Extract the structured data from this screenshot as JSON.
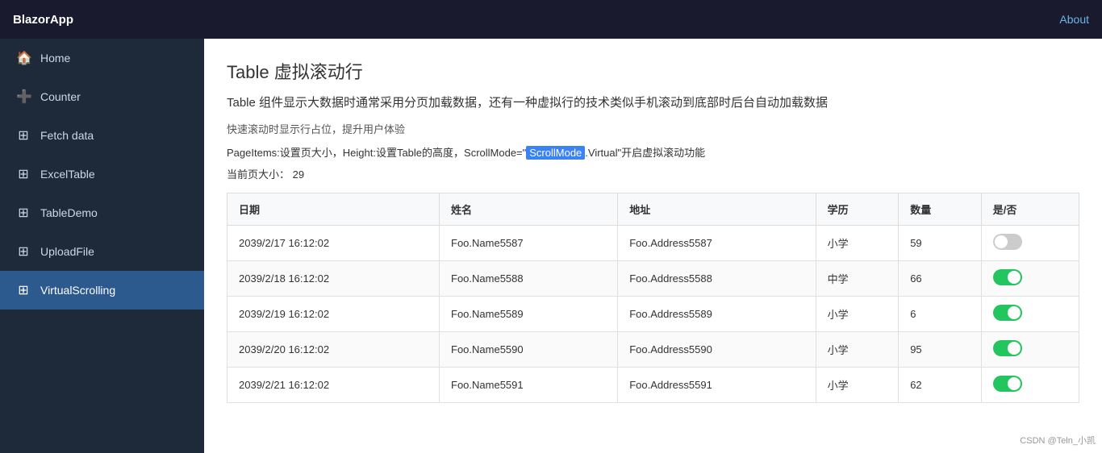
{
  "navbar": {
    "brand": "BlazorApp",
    "about_label": "About"
  },
  "sidebar": {
    "items": [
      {
        "id": "home",
        "label": "Home",
        "icon": "🏠",
        "active": false
      },
      {
        "id": "counter",
        "label": "Counter",
        "icon": "➕",
        "active": false
      },
      {
        "id": "fetch-data",
        "label": "Fetch data",
        "icon": "⊞",
        "active": false
      },
      {
        "id": "excel-table",
        "label": "ExcelTable",
        "icon": "⊞",
        "active": false
      },
      {
        "id": "table-demo",
        "label": "TableDemo",
        "icon": "⊞",
        "active": false
      },
      {
        "id": "upload-file",
        "label": "UploadFile",
        "icon": "⊞",
        "active": false
      },
      {
        "id": "virtual-scrolling",
        "label": "VirtualScrolling",
        "icon": "⊞",
        "active": true
      }
    ]
  },
  "main": {
    "title": "Table 虚拟滚动行",
    "description": "Table 组件显示大数据时通常采用分页加载数据，还有一种虚拟行的技术类似手机滚动到底部时后台自动加载数据",
    "subtitle": "快速滚动时显示行占位，提升用户体验",
    "params_prefix": "PageItems:设置页大小，Height:设置Table的高度，ScrollMode=\"",
    "params_highlight": "ScrollMode",
    "params_suffix": ".Virtual\"开启虚拟滚动功能",
    "page_size_label": "当前页大小：",
    "page_size_value": "29",
    "table": {
      "headers": [
        "日期",
        "姓名",
        "地址",
        "学历",
        "数量",
        "是/否"
      ],
      "rows": [
        {
          "date": "2039/2/17 16:12:02",
          "name": "Foo.Name5587",
          "address": "Foo.Address5587",
          "education": "小学",
          "quantity": "59",
          "toggle": false
        },
        {
          "date": "2039/2/18 16:12:02",
          "name": "Foo.Name5588",
          "address": "Foo.Address5588",
          "education": "中学",
          "quantity": "66",
          "toggle": true
        },
        {
          "date": "2039/2/19 16:12:02",
          "name": "Foo.Name5589",
          "address": "Foo.Address5589",
          "education": "小学",
          "quantity": "6",
          "toggle": true
        },
        {
          "date": "2039/2/20 16:12:02",
          "name": "Foo.Name5590",
          "address": "Foo.Address5590",
          "education": "小学",
          "quantity": "95",
          "toggle": true
        },
        {
          "date": "2039/2/21 16:12:02",
          "name": "Foo.Name5591",
          "address": "Foo.Address5591",
          "education": "小学",
          "quantity": "62",
          "toggle": true
        }
      ]
    }
  },
  "watermark": "CSDN @Teln_小凯"
}
